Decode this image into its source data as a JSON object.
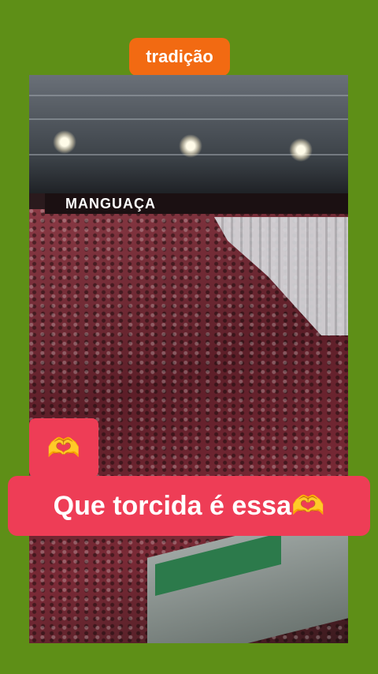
{
  "tag": {
    "label": "tradição"
  },
  "video": {
    "banner_text": "MANGUAÇA"
  },
  "emoji_box": {
    "emoji": "🫶"
  },
  "caption": {
    "text": "Que torcida é essa🫶"
  },
  "colors": {
    "background": "#5e8f17",
    "tag": "#f26a12",
    "caption": "#ee3d56"
  }
}
